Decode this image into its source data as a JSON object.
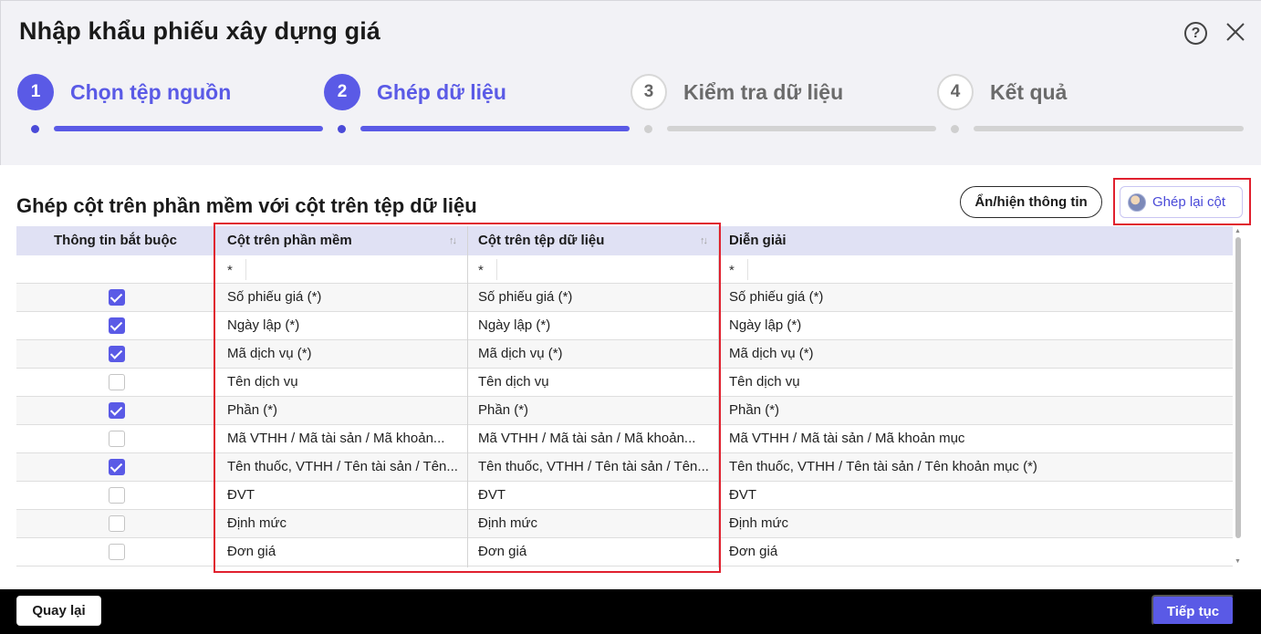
{
  "dialog": {
    "title": "Nhập khẩu phiếu xây dựng giá"
  },
  "steps": [
    {
      "number": "1",
      "label": "Chọn tệp nguồn",
      "state": "active"
    },
    {
      "number": "2",
      "label": "Ghép dữ liệu",
      "state": "active"
    },
    {
      "number": "3",
      "label": "Kiểm tra dữ liệu",
      "state": "inactive"
    },
    {
      "number": "4",
      "label": "Kết quả",
      "state": "inactive"
    }
  ],
  "section": {
    "title": "Ghép cột trên phần mềm với cột trên tệp dữ liệu",
    "toggle_info_label": "Ẩn/hiện thông tin",
    "remap_label": "Ghép lại cột"
  },
  "table": {
    "columns": [
      "Thông tin bắt buộc",
      "Cột trên phần mềm",
      "Cột trên tệp dữ liệu",
      "Diễn giải"
    ],
    "filter_placeholder": "*",
    "rows": [
      {
        "required": true,
        "software": "Số phiếu giá (*)",
        "file": "Số phiếu giá (*)",
        "description": "Số phiếu giá (*)"
      },
      {
        "required": true,
        "software": "Ngày lập (*)",
        "file": "Ngày lập (*)",
        "description": "Ngày lập (*)"
      },
      {
        "required": true,
        "software": "Mã dịch vụ (*)",
        "file": "Mã dịch vụ (*)",
        "description": "Mã dịch vụ (*)"
      },
      {
        "required": false,
        "software": "Tên dịch vụ",
        "file": "Tên dịch vụ",
        "description": "Tên dịch vụ"
      },
      {
        "required": true,
        "software": "Phần (*)",
        "file": "Phần (*)",
        "description": "Phần (*)"
      },
      {
        "required": false,
        "software": "Mã VTHH / Mã tài sản / Mã khoản...",
        "file": "Mã VTHH / Mã tài sản / Mã khoản...",
        "description": "Mã VTHH / Mã tài sản / Mã khoản mục"
      },
      {
        "required": true,
        "software": "Tên thuốc, VTHH / Tên tài sản / Tên...",
        "file": "Tên thuốc, VTHH / Tên tài sản / Tên...",
        "description": "Tên thuốc, VTHH / Tên tài sản / Tên khoản mục (*)"
      },
      {
        "required": false,
        "software": "ĐVT",
        "file": "ĐVT",
        "description": "ĐVT"
      },
      {
        "required": false,
        "software": "Định mức",
        "file": "Định mức",
        "description": "Định mức"
      },
      {
        "required": false,
        "software": "Đơn giá",
        "file": "Đơn giá",
        "description": "Đơn giá"
      }
    ]
  },
  "footer": {
    "back_label": "Quay lại",
    "next_label": "Tiếp tục"
  },
  "colors": {
    "accent": "#5a5ae6",
    "highlight": "#e0202e",
    "header_bg": "#e0e1f4"
  }
}
